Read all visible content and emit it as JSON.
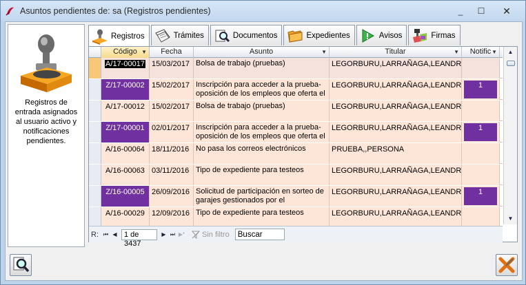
{
  "window": {
    "title": "Asuntos pendientes de: sa (Registros pendientes)",
    "minimize_glyph": "_",
    "maximize_glyph": "☐",
    "close_glyph": "✕"
  },
  "left_panel": {
    "description": "Registros de entrada asignados al usuario activo y notificaciones pendientes.",
    "icon": "stamp-icon"
  },
  "tabs": [
    {
      "label": "Registros",
      "icon": "stamp-icon",
      "active": true
    },
    {
      "label": "Trámites",
      "icon": "papers-icon"
    },
    {
      "label": "Documentos",
      "icon": "document-search-icon"
    },
    {
      "label": "Expedientes",
      "icon": "folder-icon"
    },
    {
      "label": "Avisos",
      "icon": "warning-icon"
    },
    {
      "label": "Firmas",
      "icon": "signature-stamp-icon"
    }
  ],
  "columns": [
    "Código",
    "Fecha",
    "Asunto",
    "Titular",
    "Notific"
  ],
  "rows": [
    {
      "codigo": "A/17-00017",
      "fecha": "15/03/2017",
      "asunto": "Bolsa de trabajo (pruebas)",
      "titular": "LEGORBURU,LARRAÑAGA,LEANDRO",
      "notif": ""
    },
    {
      "codigo": "Z/17-00002",
      "fecha": "15/02/2017",
      "asunto": "Inscripción para acceder a la prueba-oposición de los empleos que oferta el",
      "titular": "LEGORBURU,LARRAÑAGA,LEANDRO",
      "notif": "1"
    },
    {
      "codigo": "A/17-00012",
      "fecha": "15/02/2017",
      "asunto": "Bolsa de trabajo (pruebas)",
      "titular": "LEGORBURU,LARRAÑAGA,LEANDRO",
      "notif": ""
    },
    {
      "codigo": "Z/17-00001",
      "fecha": "02/01/2017",
      "asunto": "Inscripción para acceder a la prueba-oposición de los empleos que oferta el",
      "titular": "LEGORBURU,LARRAÑAGA,LEANDRO",
      "notif": "1"
    },
    {
      "codigo": "A/16-00064",
      "fecha": "18/11/2016",
      "asunto": "No pasa los correos electrónicos",
      "titular": "PRUEBA,,PERSONA",
      "notif": ""
    },
    {
      "codigo": "A/16-00063",
      "fecha": "03/11/2016",
      "asunto": "Tipo de expediente para testeos",
      "titular": "LEGORBURU,LARRAÑAGA,LEANDRO",
      "notif": ""
    },
    {
      "codigo": "Z/16-00005",
      "fecha": "26/09/2016",
      "asunto": "Solicitud de participación en sorteo de garajes gestionados por el",
      "titular": "LEGORBURU,LARRAÑAGA,LEANDRO",
      "notif": "1"
    },
    {
      "codigo": "A/16-00029",
      "fecha": "12/09/2016",
      "asunto": "Tipo de expediente para testeos",
      "titular": "LEGORBURU,LARRAÑAGA,LEANDRO",
      "notif": ""
    }
  ],
  "navigator": {
    "record_label": "R:",
    "position": "1 de 3437",
    "filter_label": "Sin filtro",
    "search_label": "Buscar",
    "first_glyph": "⏮",
    "prev_glyph": "◀",
    "next_glyph": "▶",
    "last_glyph": "⏭",
    "new_glyph": "▶*"
  },
  "colors": {
    "purple_highlight": "#7030a0",
    "row_background": "#fde6d8",
    "current_row_indicator": "#f8c878"
  }
}
